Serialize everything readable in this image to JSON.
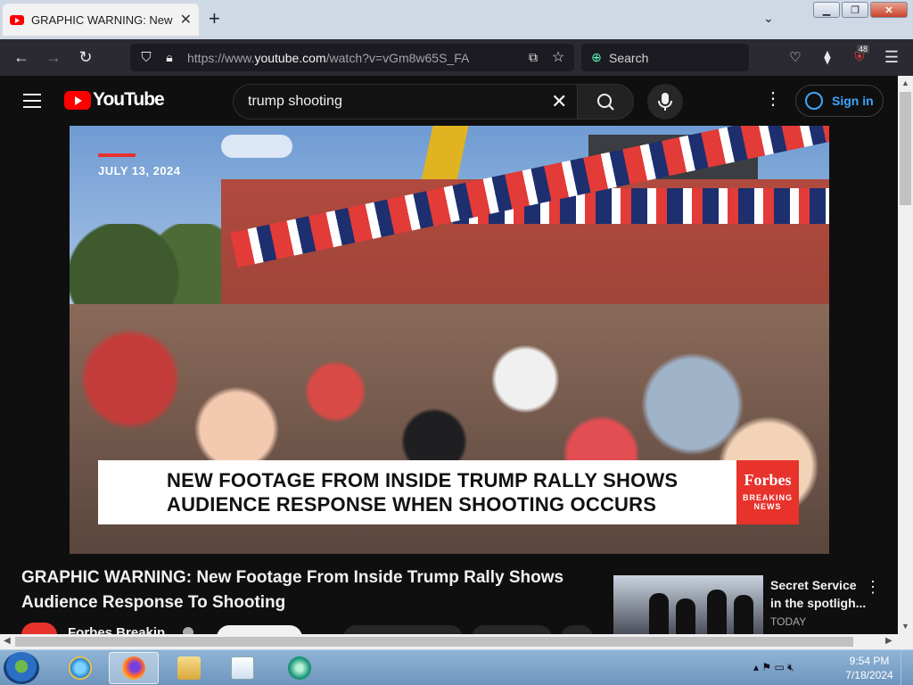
{
  "browser": {
    "tab_title": "GRAPHIC WARNING: New Foot",
    "url_prefix": "https://www.",
    "url_host": "youtube.com",
    "url_path": "/watch?v=vGm8w65S_FA",
    "search_placeholder": "Search",
    "extension_badge": "48"
  },
  "youtube": {
    "logo_text": "YouTube",
    "search_query": "trump shooting",
    "sign_in_label": "Sign in",
    "accent": "#3ea6ff"
  },
  "video": {
    "overlay_date": "JULY 13, 2024",
    "lower_third_line1": "NEW FOOTAGE FROM INSIDE TRUMP RALLY SHOWS",
    "lower_third_line2": "AUDIENCE RESPONSE WHEN SHOOTING OCCURS",
    "brand_name": "Forbes",
    "brand_tag_line1": "BREAKING",
    "brand_tag_line2": "NEWS",
    "title": "GRAPHIC WARNING: New Footage From Inside Trump Rally Shows Audience Response To Shooting",
    "channel_name": "Forbes Breakin"
  },
  "related": {
    "title": "Secret Service in the spotligh...",
    "meta": "TODAY"
  },
  "taskbar": {
    "time": "9:54 PM",
    "date": "7/18/2024"
  }
}
